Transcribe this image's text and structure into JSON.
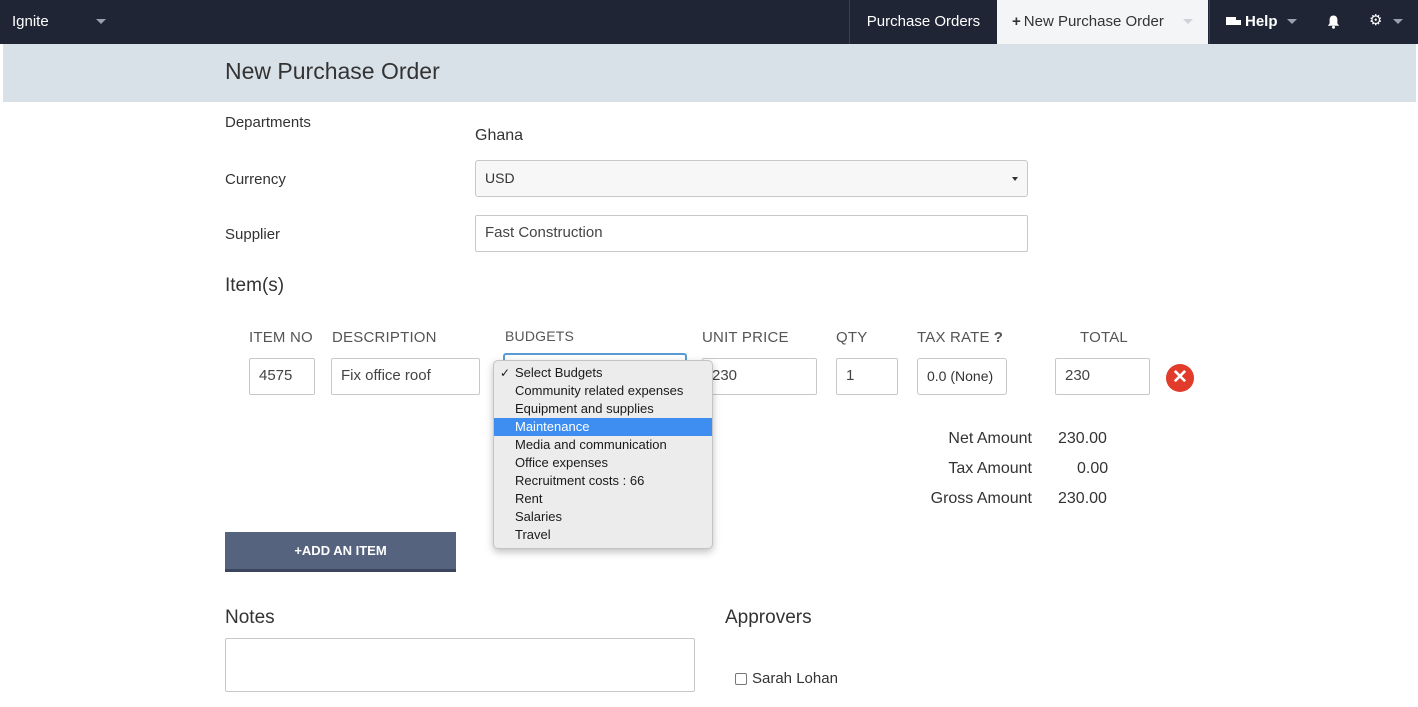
{
  "navbar": {
    "brand": "Ignite",
    "purchase_orders": "Purchase Orders",
    "new_purchase_order": "New Purchase Order",
    "help": "Help",
    "icons": [
      "chevron-down-icon",
      "plus-icon",
      "truck-icon",
      "bell-icon",
      "gear-icon"
    ]
  },
  "page": {
    "title": "New Purchase Order"
  },
  "form": {
    "departments_label": "Departments",
    "departments_value": "Ghana",
    "currency_label": "Currency",
    "currency_value": "USD",
    "supplier_label": "Supplier",
    "supplier_value": "Fast Construction"
  },
  "items": {
    "section_title": "Item(s)",
    "columns": {
      "item_no": "ITEM NO",
      "description": "DESCRIPTION",
      "budgets": "BUDGETS",
      "unit_price": "UNIT PRICE",
      "qty": "QTY",
      "tax_rate": "TAX RATE",
      "tax_help": "?",
      "total": "TOTAL"
    },
    "row": {
      "item_no": "4575",
      "description": "Fix office roof",
      "unit_price": "230",
      "qty": "1",
      "tax_rate": "0.0 (None)",
      "total": "230"
    },
    "add_button": "ADD AN ITEM"
  },
  "budget_dropdown": {
    "options": [
      "Select Budgets",
      "Community related expenses",
      "Equipment and supplies",
      "Maintenance",
      "Media and communication",
      "Office expenses",
      "Recruitment costs : 66",
      "Rent",
      "Salaries",
      "Travel"
    ],
    "checked": "Select Budgets",
    "highlighted": "Maintenance",
    "highlight_color": "#3d8ef0"
  },
  "totals": {
    "net_label": "Net Amount",
    "net_value": "230.00",
    "tax_label": "Tax Amount",
    "tax_value": "0.00",
    "gross_label": "Gross Amount",
    "gross_value": "230.00"
  },
  "notes": {
    "title": "Notes",
    "value": ""
  },
  "approvers": {
    "title": "Approvers",
    "people": [
      {
        "name": "Sarah Lohan",
        "checked": false
      }
    ]
  },
  "colors": {
    "navbar_bg": "#1f2535",
    "header_bg": "#d9e1e8",
    "button_bg": "#56637e",
    "remove_red": "#e23b2b"
  }
}
